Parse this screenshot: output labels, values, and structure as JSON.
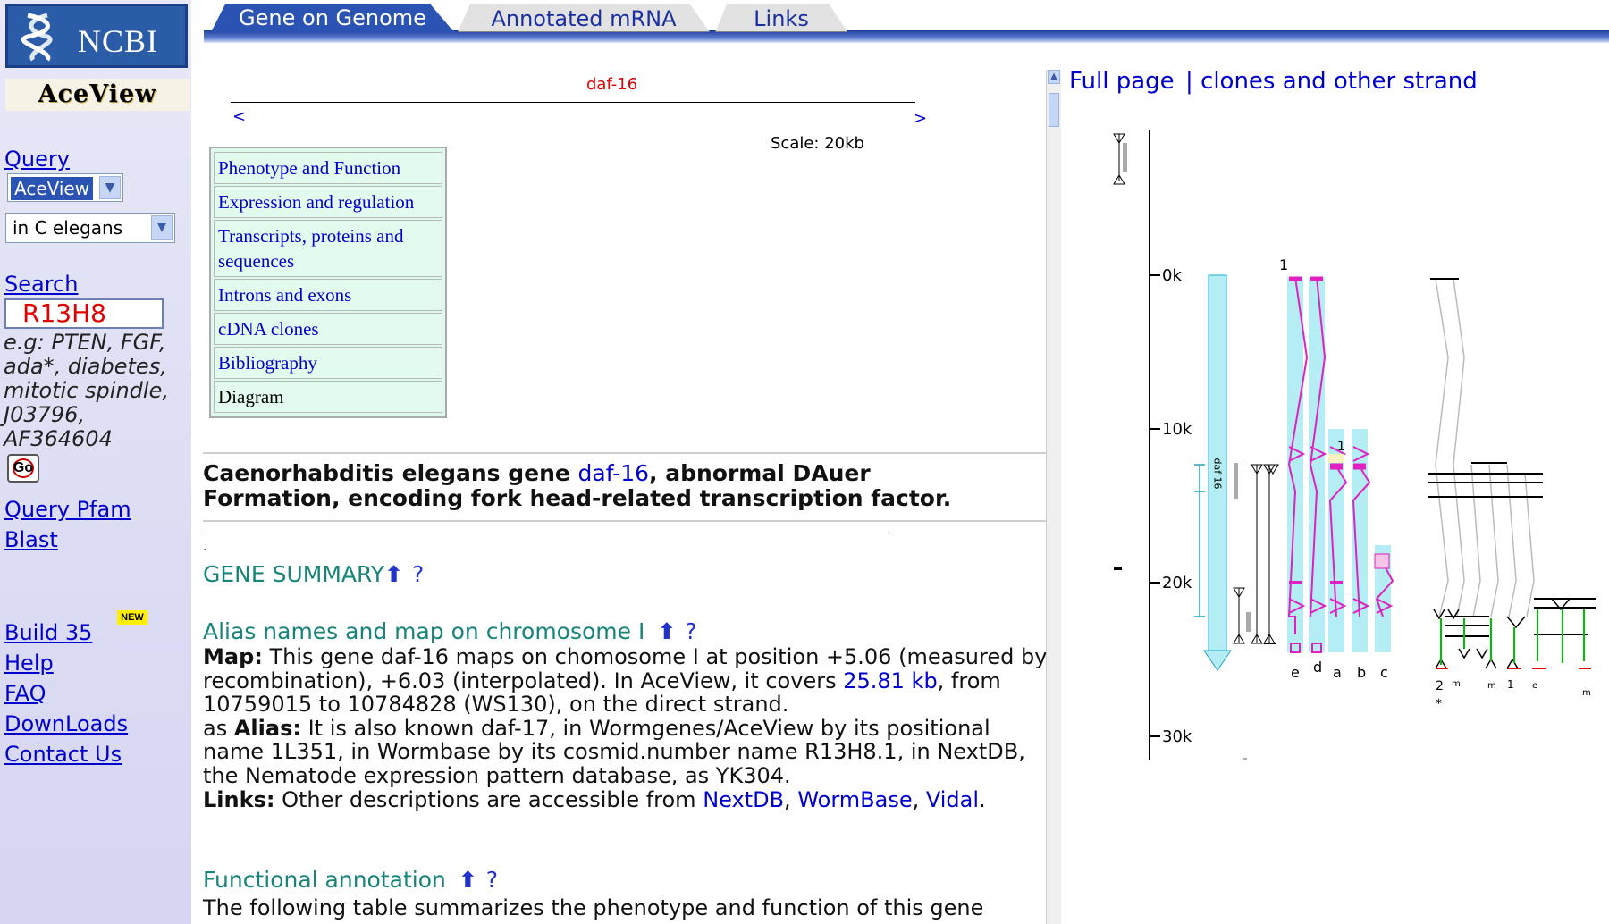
{
  "sidebar": {
    "ncbi_logo_text": "NCBI",
    "aceview_logo_text": "AceView",
    "query_label": "Query",
    "query_select": "AceView",
    "organism_select": "in C elegans",
    "search_label": "Search",
    "search_value": "R13H8",
    "examples": "e.g: PTEN, FGF, ada*, diabetes, mitotic spindle, J03796, AF364604",
    "go_label": "Go",
    "links_a": [
      "Query Pfam",
      "Blast"
    ],
    "build_label": "Build 35",
    "new_badge": "NEW",
    "links_b": [
      "Help",
      "FAQ",
      "DownLoads",
      "Contact Us"
    ]
  },
  "tabs": [
    "Gene on Genome",
    "Annotated mRNA",
    "Links"
  ],
  "map": {
    "gene_label": "daf-16",
    "prev": "<",
    "next": ">",
    "scale": "Scale: 20kb"
  },
  "toc": [
    "Phenotype and Function",
    "Expression and regulation",
    "Transcripts, proteins and sequences",
    "Introns and exons",
    "cDNA clones",
    "Bibliography",
    "Diagram"
  ],
  "heading": {
    "pre": "Caenorhabditis elegans gene ",
    "gene_link": "daf-16",
    "post": ", abnormal DAuer Formation, encoding fork head-related transcription factor."
  },
  "sections": {
    "summary_title": "GENE SUMMARY",
    "alias_title": "Alias names and map on chromosome I",
    "functional_title": "Functional annotation",
    "question_mark": "?",
    "up_arrow": "⬆"
  },
  "alias_body": {
    "map_label": "Map:",
    "map_text_1": " This gene daf-16 maps on chomosome I at position +5.06 (measured by recombination), +6.03 (interpolated). In AceView, it covers ",
    "map_link": "25.81 kb",
    "map_text_2": ", from 10759015 to 10784828 (WS130), on the direct strand.",
    "alias_prefix": "as ",
    "alias_label": "Alias:",
    "alias_text": " It is also known daf-17, in Wormgenes/AceView by its positional name 1L351, in Wormbase by its cosmid.number name R13H8.1, in NextDB, the Nematode expression pattern database, as YK304.",
    "links_label": "Links:",
    "links_text": " Other descriptions are accessible from ",
    "link_nextdb": "NextDB",
    "link_wormbase": "WormBase",
    "link_vidal": "Vidal",
    "comma": ", ",
    "period": "."
  },
  "functional_body": "The following table summarizes the phenotype and function of this gene",
  "right_panel": {
    "full_page": "Full page",
    "clones_strand": "| clones and other strand",
    "axis_ticks": [
      "0k",
      "10k",
      "20k",
      "30k"
    ],
    "transcript_labels": [
      "e",
      "d",
      "a",
      "b",
      "c"
    ],
    "marker_1": "1",
    "gene_vertical": "daf-16",
    "clone_labels": [
      "2",
      "m",
      "m",
      "1",
      "e",
      "m"
    ],
    "asterisk": "*"
  },
  "colors": {
    "ncbi_blue": "#2a5ca8",
    "tab_active": "#2a53b3",
    "section_green": "#17847a",
    "exon_magenta": "#e020c0",
    "transcript_cyan": "#b4eef4",
    "link_blue": "#0000cc"
  }
}
